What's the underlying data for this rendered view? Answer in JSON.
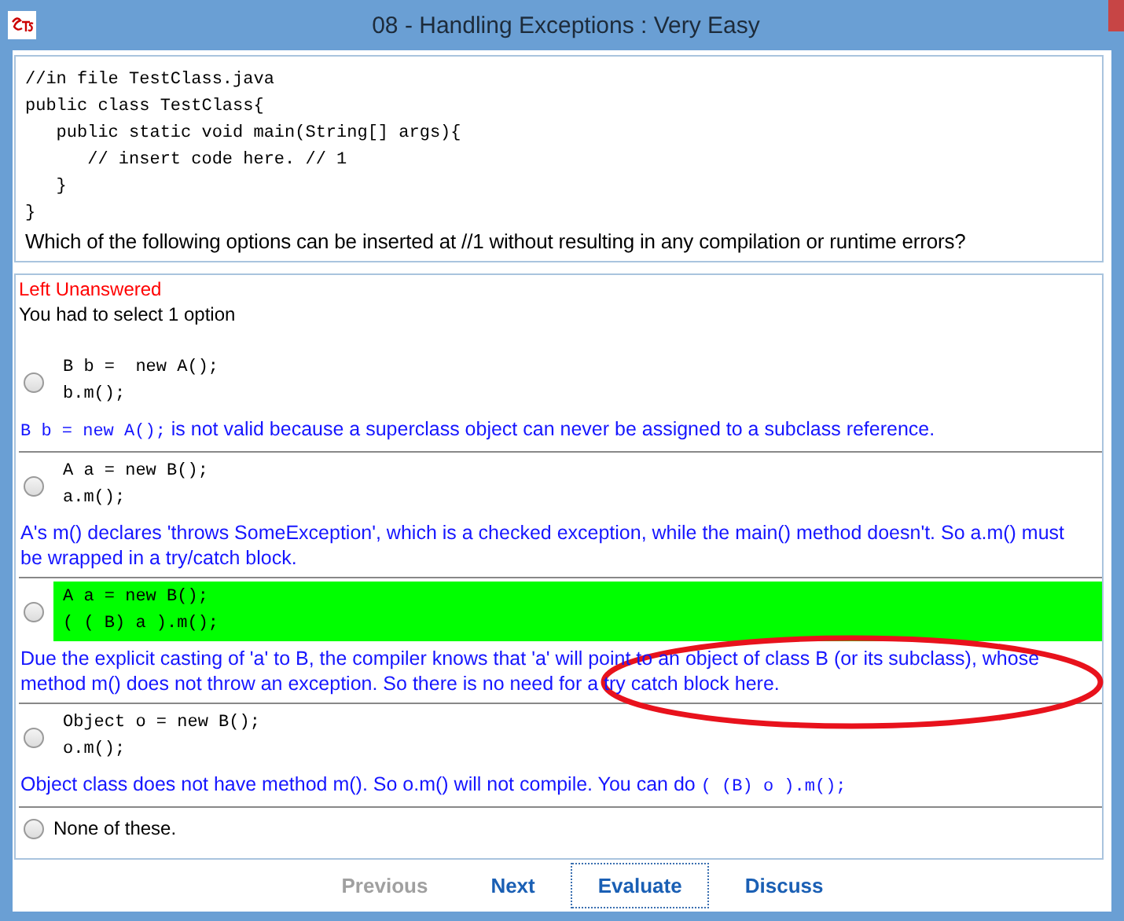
{
  "window": {
    "title": "08 - Handling Exceptions : Very Easy"
  },
  "question": {
    "code_lines": [
      "//in file TestClass.java",
      "public class TestClass{",
      "   public static void main(String[] args){",
      "      // insert code here. // 1",
      "   }",
      "}"
    ],
    "text": "Which of the following options can be inserted at //1 without resulting in any compilation or runtime errors?"
  },
  "result": {
    "status": "Left Unanswered",
    "instruction": "You had to select 1 option"
  },
  "options": [
    {
      "selected": false,
      "correct": false,
      "annotated": false,
      "code_lines": [
        "B b =  new A();",
        "b.m();"
      ],
      "explanation": [
        {
          "kind": "code",
          "text": "B b = new A();"
        },
        {
          "kind": "text",
          "text": " is not valid because a superclass object can never be assigned to a subclass reference."
        }
      ]
    },
    {
      "selected": false,
      "correct": false,
      "annotated": false,
      "code_lines": [
        "A a = new B();",
        "a.m();"
      ],
      "explanation": [
        {
          "kind": "text",
          "text": "A's m() declares 'throws SomeException', which is a checked exception, while the main() method doesn't. So a.m() must be wrapped in a try/catch block."
        }
      ]
    },
    {
      "selected": false,
      "correct": true,
      "annotated": true,
      "code_lines": [
        "A a = new B();",
        "( ( B) a ).m();"
      ],
      "explanation": [
        {
          "kind": "text",
          "text": "Due the explicit casting of 'a' to B, the compiler knows that 'a' will point to an object of class B (or its subclass), whose method m() does not throw an exception. So there is no need for a try catch block here."
        }
      ]
    },
    {
      "selected": false,
      "correct": false,
      "annotated": false,
      "code_lines": [
        "Object o = new B();",
        "o.m();"
      ],
      "explanation": [
        {
          "kind": "text",
          "text": "Object class does not have method m(). So o.m() will not compile. You can do "
        },
        {
          "kind": "code",
          "text": "( (B) o ).m();"
        }
      ]
    },
    {
      "selected": false,
      "correct": false,
      "annotated": false,
      "label": "None of these."
    }
  ],
  "buttons": [
    {
      "label": "Previous",
      "disabled": true,
      "focused": false
    },
    {
      "label": "Next",
      "disabled": false,
      "focused": false
    },
    {
      "label": "Evaluate",
      "disabled": false,
      "focused": true
    },
    {
      "label": "Discuss",
      "disabled": false,
      "focused": false
    }
  ]
}
